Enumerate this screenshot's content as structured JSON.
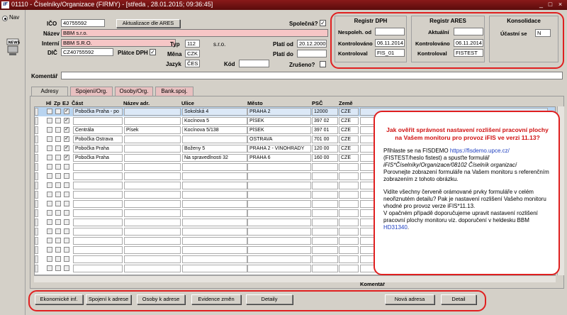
{
  "window": {
    "title": "01110 - Číselníky/Organizace (FIRMY) - [středa , 28.01.2015; 09:36:45]",
    "app_icon": "IF"
  },
  "nav": {
    "label": "Nav",
    "news_icon": "NEWS"
  },
  "form": {
    "ico_label": "IČO",
    "ico_value": "40755592",
    "ares_button": "Aktualizace dle ARES",
    "spolecna_label": "Společná?",
    "nazev_label": "Název",
    "nazev_value": "BBM s.r.o.",
    "interni_label": "Interní",
    "interni_value": "BBM S.R.O.",
    "dic_label": "DIČ",
    "dic_value": "CZ40755592",
    "platce_label": "Plátce DPH",
    "typ_label": "Typ",
    "typ_value": "112",
    "typ_desc": "s.r.o.",
    "mena_label": "Měna",
    "mena_value": "CZK",
    "jazyk_label": "Jazyk",
    "jazyk_value": "ČES",
    "kod_label": "Kód",
    "plati_od_label": "Platí od",
    "plati_od_value": "20.12.2000",
    "plati_do_label": "Platí do",
    "zruseno_label": "Zrušeno?",
    "komentar_label": "Komentář"
  },
  "dph": {
    "title": "Registr DPH",
    "nespolehlivy_label": "Nespoleh. od",
    "kontrolovano_label": "Kontrolováno",
    "kontrolovano_value": "06.11.2014",
    "kontroloval_label": "Kontroloval",
    "kontroloval_value": "FIS_01"
  },
  "ares": {
    "title": "Registr ARES",
    "aktualni_label": "Aktuální",
    "kontrolovano_label": "Kontrolováno",
    "kontrolovano_value": "06.11.2014",
    "kontroloval_label": "Kontroloval",
    "kontroloval_value": "FISTEST"
  },
  "konsolidace": {
    "title": "Konsolidace",
    "ucastni_label": "Účastní se",
    "ucastni_value": "N"
  },
  "tabs": [
    "Adresy",
    "Spojení/Org.",
    "Osoby/Org.",
    "Bank.spoj."
  ],
  "grid": {
    "headers": [
      "Hl",
      "Zp",
      "EJ",
      "Část",
      "Název adr.",
      "Ulice",
      "Město",
      "PSČ",
      "Země",
      "Komentář"
    ],
    "rows": [
      {
        "cast": "Pobočka Praha - po",
        "nazev": "",
        "ulice": "Sokolská 4",
        "mesto": "PRAHA 2",
        "psc": "12000",
        "zeme": "CZE"
      },
      {
        "cast": "",
        "nazev": "",
        "ulice": "Kocínova 5",
        "mesto": "PÍSEK",
        "psc": "397 02",
        "zeme": "CZE"
      },
      {
        "cast": "Centrála",
        "nazev": "Písek",
        "ulice": "Kocínova 5/138",
        "mesto": "PÍSEK",
        "psc": "397 01",
        "zeme": "CZE"
      },
      {
        "cast": "Pobočka Ostrava",
        "nazev": "",
        "ulice": "",
        "mesto": "OSTRAVA",
        "psc": "701 00",
        "zeme": "CZE"
      },
      {
        "cast": "Pobočka Praha",
        "nazev": "",
        "ulice": "Boženy 5",
        "mesto": "PRAHA 2 - VINOHRADY",
        "psc": "120 00",
        "zeme": "CZE"
      },
      {
        "cast": "Pobočka Praha",
        "nazev": "",
        "ulice": "Na spravedlnosti 32",
        "mesto": "PRAHA 6",
        "psc": "160 00",
        "zeme": "CZE"
      }
    ]
  },
  "note": {
    "title": "Jak ověřit správnost nastavení rozlišení pracovní plochy na Vašem monitoru  pro provoz iFIS ve verzi 11.13?",
    "p1_a": "Přihlaste se na FISDEMO ",
    "p1_link": "https://fisdemo.upce.cz/",
    "p1_b": "(FISTEST/heslo fistest) a spusťte formulář ",
    "p1_form": "iFIS*Číselníky/Organizace/08102 Číselník organizací",
    "p1_c": "Porovnejte zobrazení formuláře na Vašem monitoru s referenčním zobrazením z tohoto obrázku.",
    "p2": "Vidíte všechny červeně orámované prvky formuláře v celém neořiznutém detailu? Pak je nastavení rozlišení Vašeho monitoru vhodné pro provoz verze iFIS*11.13.",
    "p3_a": "V opačném případě doporučujeme upravit nastavení rozlišení pracovní plochy monitoru viz. doporučení v heldesku BBM ",
    "p3_link": "HD31340",
    "p3_b": "."
  },
  "buttons": {
    "ekonomicke": "Ekonomické inf.",
    "spojeni": "Spojení k adrese",
    "osoby": "Osoby k adrese",
    "evidence": "Evidence změn",
    "detaily": "Detaily",
    "nova": "Nová adresa",
    "detail": "Detail"
  },
  "colors": {
    "title_bar": "#7a1414",
    "highlight": "#e02020",
    "pink_field": "#f6c6c6",
    "tab_inactive": "#e8c0c0"
  }
}
